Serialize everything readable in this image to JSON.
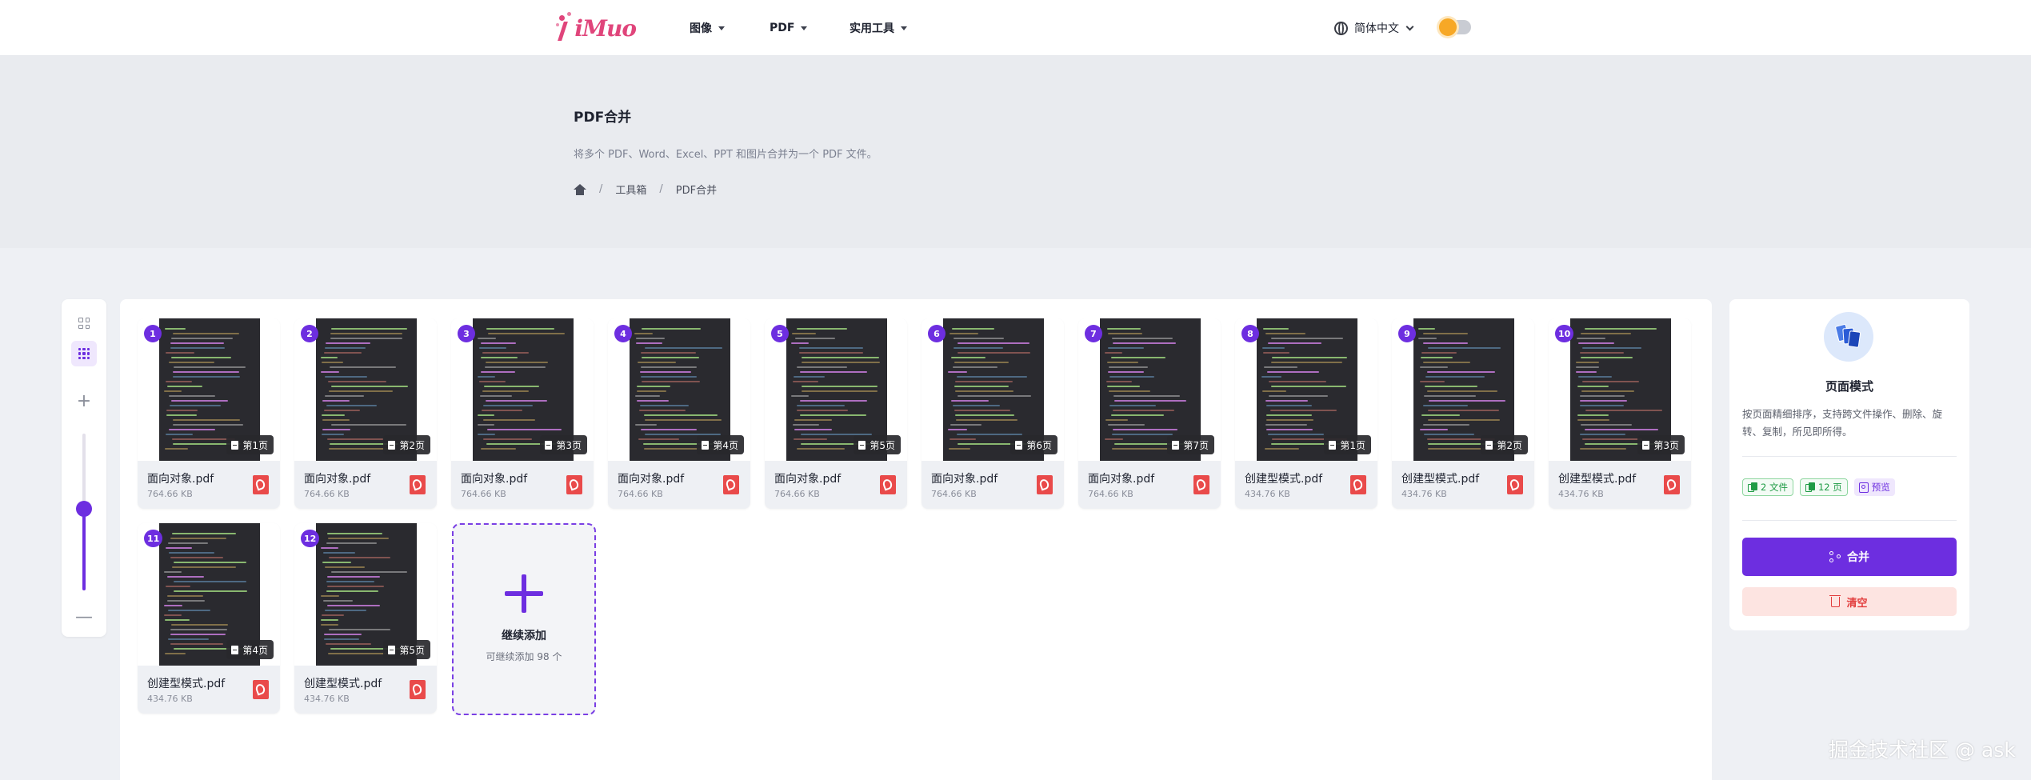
{
  "nav": {
    "logo_text": "iMuo",
    "menu": [
      {
        "label": "图像"
      },
      {
        "label": "PDF"
      },
      {
        "label": "实用工具"
      }
    ],
    "language": "简体中文"
  },
  "hero": {
    "title": "PDF合并",
    "subtitle": "将多个 PDF、Word、Excel、PPT 和图片合并为一个 PDF 文件。",
    "breadcrumb": [
      "工具箱",
      "PDF合并"
    ]
  },
  "view_controls": {
    "zoom_plus": "+",
    "zoom_minus": "—",
    "zoom_level": 0.52
  },
  "cards": [
    {
      "index": "1",
      "page": "第1页",
      "name": "面向对象.pdf",
      "size": "764.66 KB"
    },
    {
      "index": "2",
      "page": "第2页",
      "name": "面向对象.pdf",
      "size": "764.66 KB"
    },
    {
      "index": "3",
      "page": "第3页",
      "name": "面向对象.pdf",
      "size": "764.66 KB"
    },
    {
      "index": "4",
      "page": "第4页",
      "name": "面向对象.pdf",
      "size": "764.66 KB"
    },
    {
      "index": "5",
      "page": "第5页",
      "name": "面向对象.pdf",
      "size": "764.66 KB"
    },
    {
      "index": "6",
      "page": "第6页",
      "name": "面向对象.pdf",
      "size": "764.66 KB"
    },
    {
      "index": "7",
      "page": "第7页",
      "name": "面向对象.pdf",
      "size": "764.66 KB"
    },
    {
      "index": "8",
      "page": "第1页",
      "name": "创建型模式.pdf",
      "size": "434.76 KB"
    },
    {
      "index": "9",
      "page": "第2页",
      "name": "创建型模式.pdf",
      "size": "434.76 KB"
    },
    {
      "index": "10",
      "page": "第3页",
      "name": "创建型模式.pdf",
      "size": "434.76 KB"
    },
    {
      "index": "11",
      "page": "第4页",
      "name": "创建型模式.pdf",
      "size": "434.76 KB"
    },
    {
      "index": "12",
      "page": "第5页",
      "name": "创建型模式.pdf",
      "size": "434.76 KB"
    }
  ],
  "add_card": {
    "title": "继续添加",
    "subtitle": "可继续添加 98 个"
  },
  "side": {
    "title": "页面模式",
    "description": "按页面精细排序，支持跨文件操作、删除、旋转、复制，所见即所得。",
    "files_stat": "2 文件",
    "pages_stat": "12 页",
    "preview_label": "预览",
    "merge_label": "合并",
    "clear_label": "清空"
  },
  "watermark": "掘金技术社区 @ ask",
  "colors": {
    "accent": "#6d2ee0",
    "logo": "#e0457b",
    "danger": "#e23c3c",
    "success": "#1f9b45"
  }
}
